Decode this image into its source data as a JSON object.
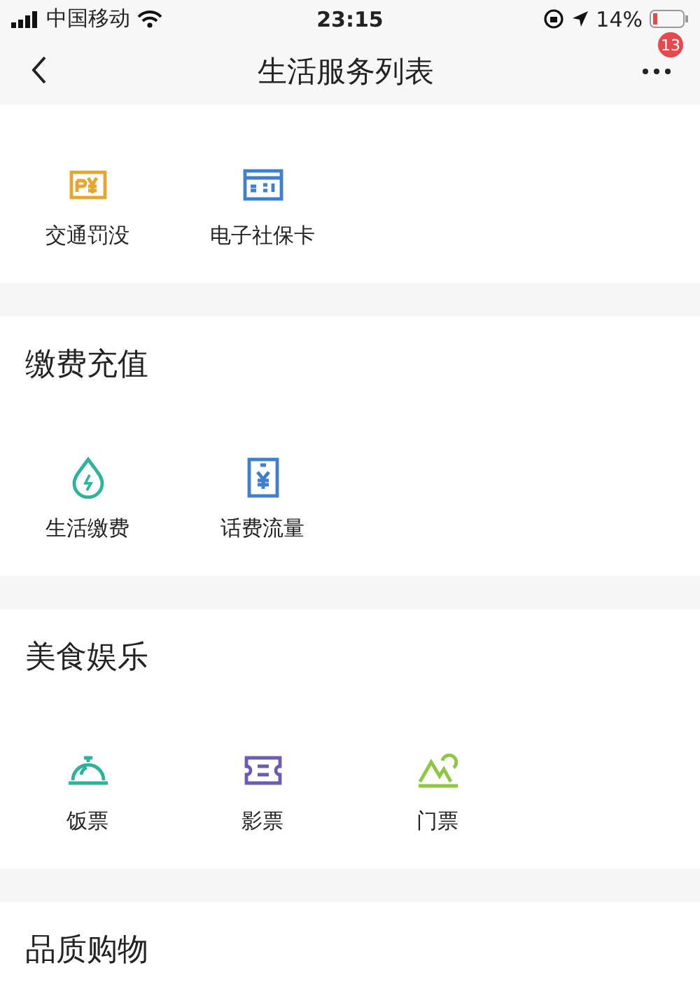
{
  "status_bar": {
    "carrier": "中国移动",
    "time": "23:15",
    "battery_percent": "14%"
  },
  "nav_bar": {
    "title": "生活服务列表",
    "badge": "13"
  },
  "sections": [
    {
      "items": [
        {
          "label": "交通罚没",
          "kind": "fine"
        },
        {
          "label": "电子社保卡",
          "kind": "card"
        }
      ]
    },
    {
      "title": "缴费充值",
      "items": [
        {
          "label": "生活缴费",
          "kind": "drop"
        },
        {
          "label": "话费流量",
          "kind": "phone"
        }
      ]
    },
    {
      "title": "美食娱乐",
      "items": [
        {
          "label": "饭票",
          "kind": "dish"
        },
        {
          "label": "影票",
          "kind": "ticket"
        },
        {
          "label": "门票",
          "kind": "mountain"
        }
      ]
    },
    {
      "title": "品质购物"
    }
  ]
}
